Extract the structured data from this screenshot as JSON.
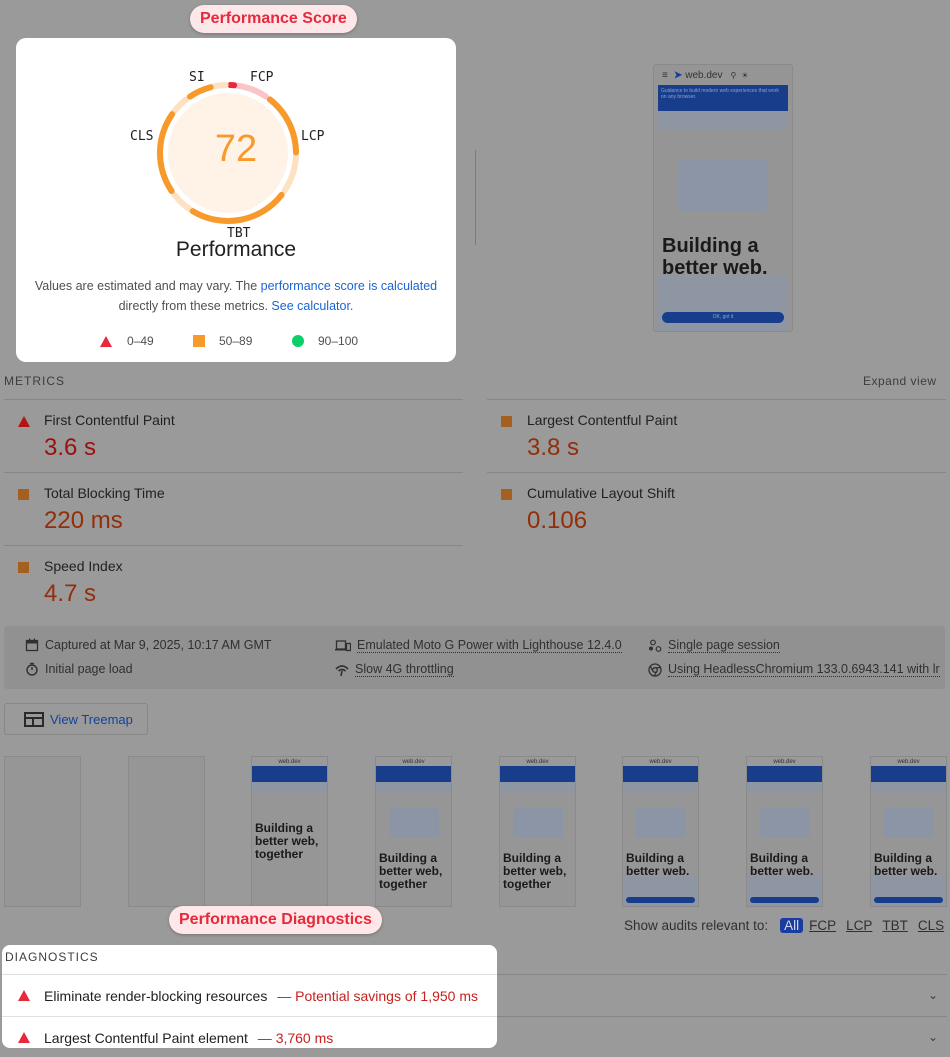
{
  "callouts": {
    "score": "Performance Score",
    "diagnostics": "Performance Diagnostics"
  },
  "gauge": {
    "score": "72",
    "title": "Performance",
    "labels": {
      "si": "SI",
      "fcp": "FCP",
      "lcp": "LCP",
      "tbt": "TBT",
      "cls": "CLS"
    },
    "segments": [
      {
        "metric": "FCP",
        "weight": 10,
        "score": 0.1,
        "color": "#e8293b",
        "track": "#fbc4c8"
      },
      {
        "metric": "LCP",
        "weight": 25,
        "score": 0.6,
        "color": "#f79a2b",
        "track": "#fde1c0"
      },
      {
        "metric": "TBT",
        "weight": 30,
        "score": 0.8,
        "color": "#f79a2b",
        "track": "#fde1c0"
      },
      {
        "metric": "CLS",
        "weight": 25,
        "score": 0.8,
        "color": "#f79a2b",
        "track": "#fde1c0"
      },
      {
        "metric": "SI",
        "weight": 10,
        "score": 0.6,
        "color": "#f79a2b",
        "track": "#fde1c0"
      }
    ],
    "description_prefix": "Values are estimated and may vary. The ",
    "description_link1": "performance score is calculated",
    "description_mid": "directly from these metrics. ",
    "description_link2": "See calculator.",
    "legend": {
      "fail": "0–49",
      "average": "50–89",
      "pass": "90–100"
    }
  },
  "screenshot": {
    "site_name": "web.dev",
    "heading": "Building a better web.",
    "banner": "Guidance to build modern web experiences that work on any browser.",
    "cookie_button": "OK, got it"
  },
  "metrics": {
    "header": "METRICS",
    "expand": "Expand view",
    "items": [
      {
        "label": "First Contentful Paint",
        "value": "3.6 s",
        "rating": "fail",
        "color": "#9e0e0e"
      },
      {
        "label": "Largest Contentful Paint",
        "value": "3.8 s",
        "rating": "average",
        "color": "#922e0a"
      },
      {
        "label": "Total Blocking Time",
        "value": "220 ms",
        "rating": "average",
        "color": "#922e0a"
      },
      {
        "label": "Cumulative Layout Shift",
        "value": "0.106",
        "rating": "average",
        "color": "#922e0a"
      },
      {
        "label": "Speed Index",
        "value": "4.7 s",
        "rating": "average",
        "color": "#922e0a"
      }
    ]
  },
  "environment": {
    "captured": "Captured at Mar 9, 2025, 10:17 AM GMT",
    "load": "Initial page load",
    "device": "Emulated Moto G Power with Lighthouse 12.4.0",
    "throttling": "Slow 4G throttling",
    "session": "Single page session",
    "browser": "Using HeadlessChromium 133.0.6943.141 with lr"
  },
  "treemap": {
    "label": "View Treemap"
  },
  "filmstrip": {
    "site_name": "web.dev",
    "heading_full": "Building a better web, together",
    "heading_cut": "Building a better web."
  },
  "filter": {
    "label": "Show audits relevant to:",
    "options": [
      "All",
      "FCP",
      "LCP",
      "TBT",
      "CLS"
    ],
    "active": "All"
  },
  "diagnostics": {
    "header": "DIAGNOSTICS",
    "items": [
      {
        "title": "Eliminate render-blocking resources",
        "detail": "Potential savings of 1,950 ms"
      },
      {
        "title": "Largest Contentful Paint element",
        "detail": "3,760 ms"
      }
    ],
    "separator": "—"
  }
}
